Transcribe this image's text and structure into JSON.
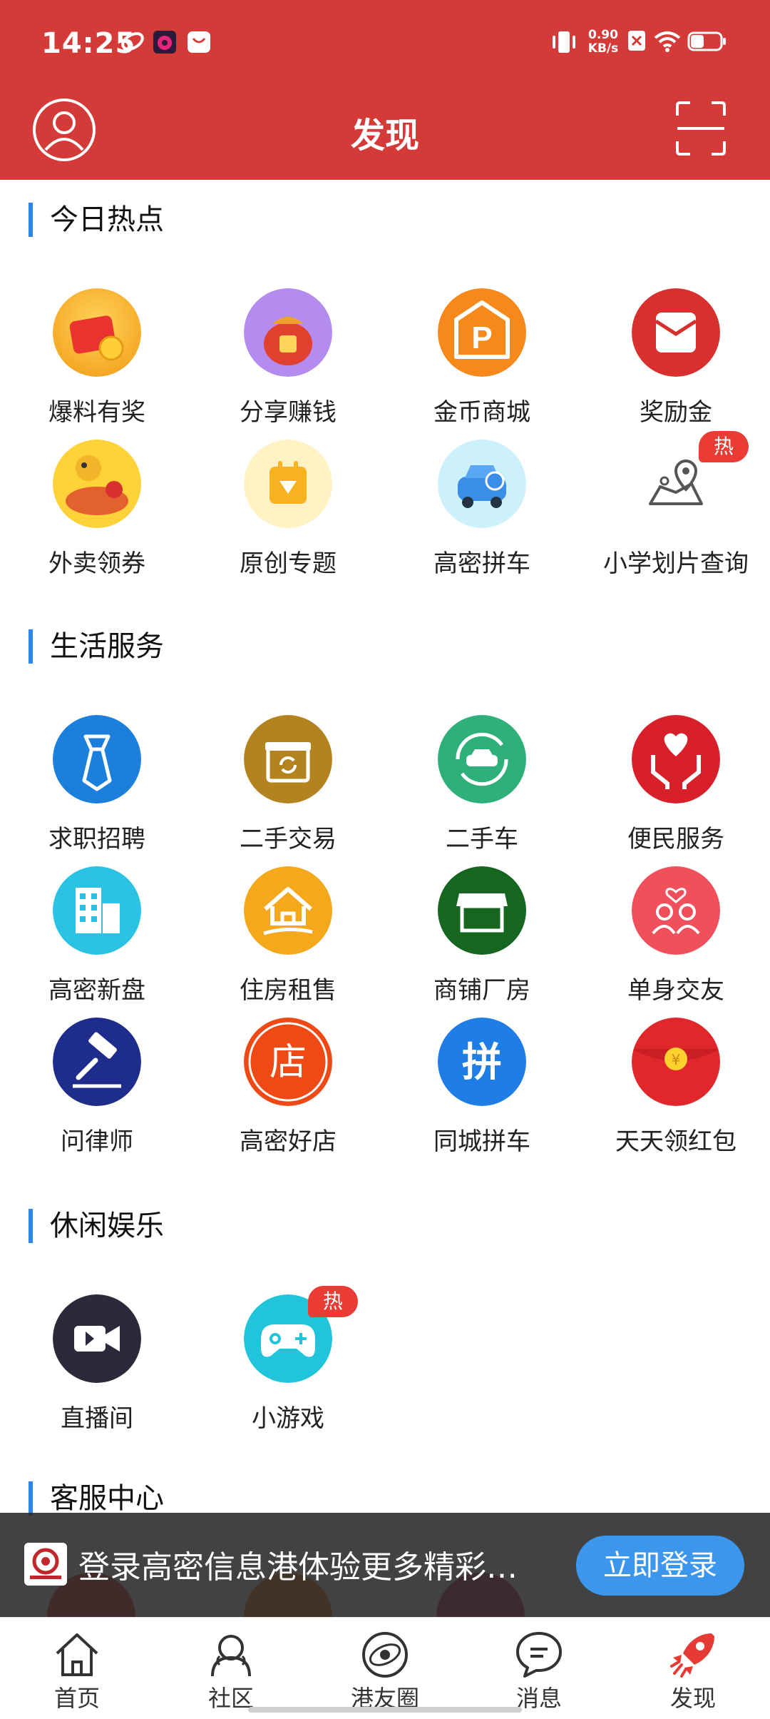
{
  "status_bar": {
    "time": "14:25",
    "net_speed_value": "0.90",
    "net_speed_unit": "KB/s"
  },
  "nav": {
    "title": "发现",
    "avatar_icon": "user-avatar-icon",
    "scan_icon": "scan-icon"
  },
  "sections": {
    "today_hot": {
      "title": "今日热点",
      "items": [
        {
          "label": "爆料有奖"
        },
        {
          "label": "分享赚钱"
        },
        {
          "label": "金币商城"
        },
        {
          "label": "奖励金"
        },
        {
          "label": "外卖领券"
        },
        {
          "label": "原创专题"
        },
        {
          "label": "高密拼车"
        },
        {
          "label": "小学划片查询",
          "badge": "热"
        }
      ]
    },
    "life": {
      "title": "生活服务",
      "items": [
        {
          "label": "求职招聘"
        },
        {
          "label": "二手交易"
        },
        {
          "label": "二手车"
        },
        {
          "label": "便民服务"
        },
        {
          "label": "高密新盘"
        },
        {
          "label": "住房租售"
        },
        {
          "label": "商铺厂房"
        },
        {
          "label": "单身交友"
        },
        {
          "label": "问律师"
        },
        {
          "label": "高密好店",
          "icon_text": "店"
        },
        {
          "label": "同城拼车",
          "icon_text": "拼"
        },
        {
          "label": "天天领红包"
        }
      ]
    },
    "leisure": {
      "title": "休闲娱乐",
      "items": [
        {
          "label": "直播间"
        },
        {
          "label": "小游戏",
          "badge": "热"
        }
      ]
    },
    "service": {
      "title": "客服中心"
    }
  },
  "login_banner": {
    "text": "登录高密信息港体验更多精彩…",
    "button": "立即登录"
  },
  "bottom_nav": [
    {
      "label": "首页"
    },
    {
      "label": "社区"
    },
    {
      "label": "港友圈"
    },
    {
      "label": "消息"
    },
    {
      "label": "发现"
    }
  ],
  "colors": {
    "header_red": "#d43a37",
    "accent_blue": "#2f86e6",
    "login_button": "#3c96ec",
    "hot_badge": "#ea3b35"
  }
}
